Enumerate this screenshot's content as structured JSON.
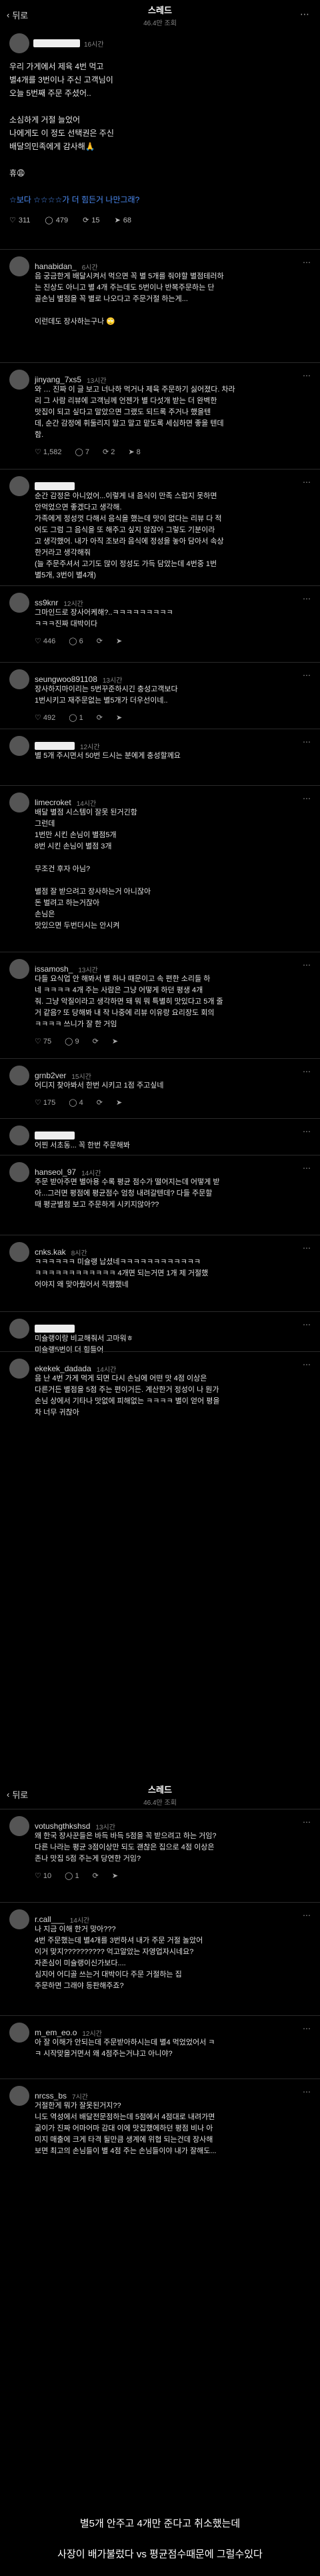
{
  "topbar": {
    "back_label": "뒤로",
    "title": "스레드",
    "subtitle": "46.4만 조회"
  },
  "post": {
    "time": "16시간",
    "lines": [
      "우리 가게에서 제육 4번 먹고",
      "별4개를 3번이나 주신 고객님이",
      "오늘 5번째 주문 주셨어..",
      "",
      "소심하게 거절 늘었어",
      "나에게도 이 정도 선택권은 주신",
      "배달의민족에게 감사해🙏",
      "",
      "휴😩",
      "",
      "☆보다 ☆☆☆☆가 더 힘든거 나만그래?"
    ],
    "stats": {
      "likes": "311",
      "comments": "479",
      "reposts": "15",
      "shares": "68"
    }
  },
  "comments": [
    {
      "user": "hanabidan_",
      "time": "6시간",
      "body": [
        "음 궁금한게 배달시켜서 먹으면 꼭 별 5개를 줘야할 별점테러하",
        "는 진상도 아니고 별 4개 주는데도 5번이나 반복주문하는 단",
        "골손님 별점을 꼭 별로 나오다고 주문거절 하는게...",
        "",
        "이런데도 장사하는구나 🙄"
      ],
      "likes": "",
      "comments": "",
      "reposts": "",
      "shares": ""
    },
    {
      "user": "jinyang_7xs5",
      "time": "13시간",
      "body": [
        "와 … 진짜 이 글 보고 너나하 먹거나 제육 주문하기 싫어졌다. 차라",
        "리 그 사람 리뷰에 고객님께 언젠가 별 다섯개 받는 더 완벽한",
        "맛집이 되고 싶다고 말았으면 그랬도 되드록 주거나 했을텐",
        "데, 순간 감정에 휘둘리지 말고 말고 맡도록 세심하면 좋을 텐데",
        "함."
      ],
      "likes": "1,582",
      "comments": "7",
      "reposts": "2",
      "shares": "8"
    },
    {
      "user": "",
      "time": "",
      "body": [
        "순간 감정은 아니었어...이렇게 내 음식이 만족 스럽지 못하면",
        "안먹었으면 좋겠다고 생각해.",
        "가족에게 정성껏 다해서 음식을 했는데 맛이 없다는 리뷰 다 적",
        "어도 그럼 그 음식을 또 해주고 싶지 않잖아 그렇도 기분이라",
        "고 생각했어. 내가 아직 조보라 음식에 정성을 놓아 담아서 속상",
        "한거라고 생각해줘",
        "(늘 주문주셔서 고기도 많이 정성도 가득 담았는데 4번중 1번",
        "별5개, 3번이 별4개)"
      ],
      "likes": "",
      "comments": "",
      "reposts": "",
      "shares": ""
    },
    {
      "user": "ss9knr",
      "time": "12시간",
      "body": [
        "그마인드로 장사어케해?..ㅋㅋㅋㅋㅋㅋㅋㅋㅋ",
        "ㅋㅋㅋ진짜 대박이다"
      ],
      "likes": "446",
      "comments": "6",
      "reposts": "",
      "shares": ""
    },
    {
      "user": "seungwoo891108",
      "time": "13시간",
      "body": [
        "장사하지마이리는 5번꾸준하시긴 충성고객보다",
        "1번시키고 재주문없는 별5개가 더우선이네.."
      ],
      "likes": "492",
      "comments": "1",
      "reposts": "",
      "shares": ""
    },
    {
      "user": "",
      "time": "12시간",
      "body": [
        "별 5개 주시면서 50번 드시는 분에게 충성할께요"
      ],
      "likes": "",
      "comments": "",
      "reposts": "",
      "shares": ""
    },
    {
      "user": "limecroket",
      "time": "14시간",
      "body": [
        "배달 별점 시스템이 잘못 된거긴함",
        "그런데",
        "1번만 시킨 손님이 별점5개",
        "8번 시킨 손님이 별점 3개",
        "",
        "무조건 후자 아님?",
        "",
        "별점 잘 받으려고 장사하는거 아니잖아",
        "돈 벌려고 하는거잖아",
        "손님은",
        "맛있으면 두번더시는 안시켜"
      ],
      "likes": "",
      "comments": "",
      "reposts": "",
      "shares": ""
    },
    {
      "user": "issamosh_",
      "time": "13시간",
      "body": [
        "다들 요식업 안 해봐서 별 하나 때문이고 속 편한 소리들 하",
        "네 ㅋㅋㅋㅋ 4개 주는 사람은 그냥 어떻게 하던 평생 4개",
        "줘. 그냥 악질이라고 생각하면 돼 뭐 뭐 특별히 맛있다고 5개 줄",
        "거 같음? 또 당해봐 내 작 나중에 리뷰 이유랑 요리장도 회의",
        "ㅋㅋㅋㅋ 쓰니가 잘 한 거임"
      ],
      "likes": "75",
      "comments": "9",
      "reposts": "",
      "shares": ""
    },
    {
      "user": "grnb2ver",
      "time": "15시간",
      "body": [
        "어디지 찾아봐서 한번 시키고 1점 주고싶네"
      ],
      "likes": "175",
      "comments": "4",
      "reposts": "",
      "shares": ""
    },
    {
      "user": "",
      "time": "",
      "body": [
        "어찐 서초동... 꼭 한번 주문해봐"
      ],
      "likes": "",
      "comments": "",
      "reposts": "",
      "shares": ""
    },
    {
      "user": "hanseol_97",
      "time": "14시간",
      "body": [
        "주문 받아주면 별아용 수록 평균 점수가 떨어지는데 어떻게 받",
        "아...그러면 평점에 평균점수 엄청 내려갈텐데? 다들 주문할",
        "때 평균별점 보고 주문하게 시키지않아??"
      ],
      "likes": "",
      "comments": "",
      "reposts": "",
      "shares": ""
    },
    {
      "user": "cnks.kak",
      "time": "8시간",
      "body": [
        "ㅋㅋㅋㅋㅋㅋ 미슐랭 납셨네ㅋㅋㅋㅋㅋㅋㅋㅋㅋㅋㅋㅋ",
        "ㅋㅋㅋㅋㅋㅋㅋㅋㅋㅋㅋㅋ 4개면 되는거면 1개 제 거절했",
        "어야지 왜 맞아줬어서 직쪙했네"
      ],
      "likes": "",
      "comments": "",
      "reposts": "",
      "shares": ""
    },
    {
      "user": "",
      "time": "",
      "body": [
        "미슐랭이랑 비교해줘서 고마워ㅎ",
        "미슐랭5번이 더 힘들어"
      ],
      "likes": "",
      "comments": "",
      "reposts": "",
      "shares": ""
    },
    {
      "user": "ekekek_dadada",
      "time": "14시간",
      "body": [
        "음 난 4번 가게 먹게 되면 다시 손님에 어떤 맛 4점 이상은",
        "다른거든 별점을 5점 주는 편이거든. 계산한거 정성이 나 뭔가",
        "손님 상에서 기타나 맛없에 피해없는 ㅋㅋㅋㅋ 별이 얻어 평을",
        "차 너무 귀찮아"
      ],
      "likes": "",
      "comments": "",
      "reposts": "",
      "shares": ""
    }
  ],
  "second_screen": {
    "topbar": {
      "back_label": "뒤로",
      "title": "스레드",
      "subtitle": "46.4만 조회"
    },
    "comments": [
      {
        "user": "votushgthkshsd",
        "time": "13시간",
        "body": [
          "왜 한국 장사꾼들은 바득 바득 5점을 꼭 받으려고 하는 거임?",
          "다른 나라는 평균 3점이상만 되도 괜찮은 집으로 4점 이상은",
          "존나 맛집 5점 주는게 당연한 거임?"
        ],
        "likes": "10",
        "comments": "1",
        "reposts": "",
        "shares": ""
      },
      {
        "user": "r.call___",
        "time": "14시간",
        "body": [
          "나 지금 이해 한거 맞아???",
          "4번 주문했는데 별4개를 3번하셔 내가 주문 거절 놀았어",
          "이거 맞지?????????? 억고알았는 자영업자시네요?",
          "자존심이 미슐랭이신가보다....",
          "심지어 어디골 쓰는거 대박이다 주문 거절하는 집",
          "주문하면 그래야 등판해주죠?"
        ],
        "likes": "",
        "comments": "",
        "reposts": "",
        "shares": ""
      },
      {
        "user": "m_em_eo.o",
        "time": "12시간",
        "body": [
          "아 잘 이해가 안되는데 주문받아하시는데 별4 먹었었어서 ㅋ",
          "ㅋ 시작맞을거면서 왜 4점주는거냐고 아니야?"
        ],
        "likes": "",
        "comments": "",
        "reposts": "",
        "shares": ""
      },
      {
        "user": "nrcss_bs",
        "time": "7시간",
        "body": [
          "거절한게 뭐가 잘못된거지??",
          "니도 역성에서 배달전문점하는데 5점에서 4점대로 내려가면",
          "굶이가 진짜 어마어마 감대 이에 맛집했에하던 평점 비나 아",
          "미지 매출에 크게 타격 될만큼 생계에 위협 되는건데 장사해",
          "보면 최고의 손님들이 별 4점 주는 손님들이야 내가 잘해도..."
        ],
        "likes": "",
        "comments": "",
        "reposts": "",
        "shares": ""
      }
    ]
  },
  "captions": [
    "별5개 안주고 4개만 준다고 취소했는데",
    "사장이 배가불렀다 vs 평균점수때문에 그럴수있다"
  ]
}
